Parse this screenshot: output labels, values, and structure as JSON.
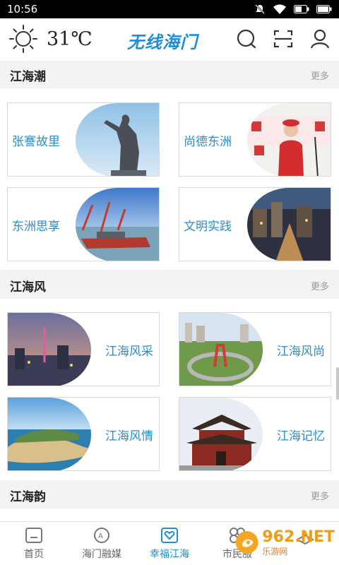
{
  "status_bar": {
    "time": "10:56"
  },
  "header": {
    "temperature": "31℃",
    "brand": "无线海门"
  },
  "sections": [
    {
      "title": "江海潮",
      "more": "更多"
    },
    {
      "title": "江海风",
      "more": "更多"
    },
    {
      "title": "江海韵",
      "more": "更多"
    }
  ],
  "cards": [
    {
      "label": "张謇故里"
    },
    {
      "label": "尚德东洲"
    },
    {
      "label": "东洲思享"
    },
    {
      "label": "文明实践"
    },
    {
      "label": "江海风采"
    },
    {
      "label": "江海风尚"
    },
    {
      "label": "江海风情"
    },
    {
      "label": "江海记忆"
    }
  ],
  "nav": [
    {
      "label": "首页"
    },
    {
      "label": "海门融媒"
    },
    {
      "label": "幸福江海"
    },
    {
      "label": "市民服"
    }
  ],
  "watermark": {
    "big": "962.NET",
    "small": "乐游网"
  },
  "colors": {
    "accent": "#1e8fd6",
    "card_text": "#2a8ec8"
  }
}
